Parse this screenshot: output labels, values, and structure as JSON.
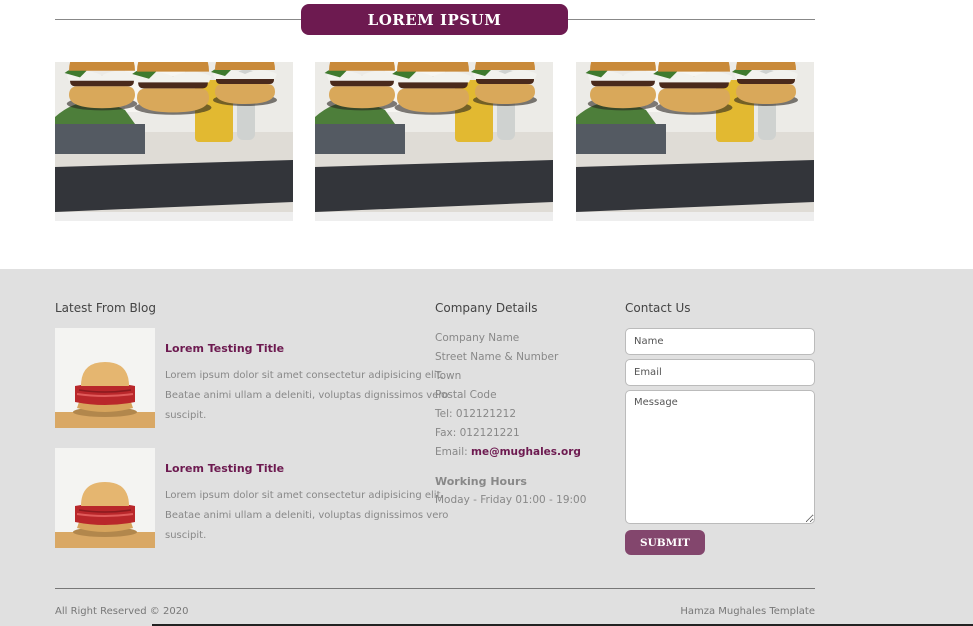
{
  "section": {
    "title": "LOREM IPSUM"
  },
  "footer": {
    "blog": {
      "title": "Latest From Blog",
      "items": [
        {
          "title": "Lorem Testing Title",
          "text": "Lorem ipsum dolor sit amet consectetur adipisicing elit. Beatae animi ullam a deleniti, voluptas dignissimos vero suscipit."
        },
        {
          "title": "Lorem Testing Title",
          "text": "Lorem ipsum dolor sit amet consectetur adipisicing elit. Beatae animi ullam a deleniti, voluptas dignissimos vero suscipit."
        }
      ]
    },
    "company": {
      "title": "Company Details",
      "name": "Company Name",
      "street": "Street Name & Number",
      "town": "Town",
      "postal": "Postal Code",
      "tel": "Tel: 012121212",
      "fax": "Fax: 012121221",
      "email_label": "Email: ",
      "email": "me@mughales.org",
      "hours_title": "Working Hours",
      "hours": "Moday - Friday 01:00 - 19:00"
    },
    "contact": {
      "title": "Contact Us",
      "name_placeholder": "Name",
      "email_placeholder": "Email",
      "message_placeholder": "Message",
      "submit_label": "SUBMIT"
    },
    "copyright": "All Right Reserved © 2020",
    "credit": "Hamza Mughales Template"
  },
  "colors": {
    "accent": "#6d1a50",
    "button": "#83466d",
    "footer_bg": "#e0e0e0"
  }
}
